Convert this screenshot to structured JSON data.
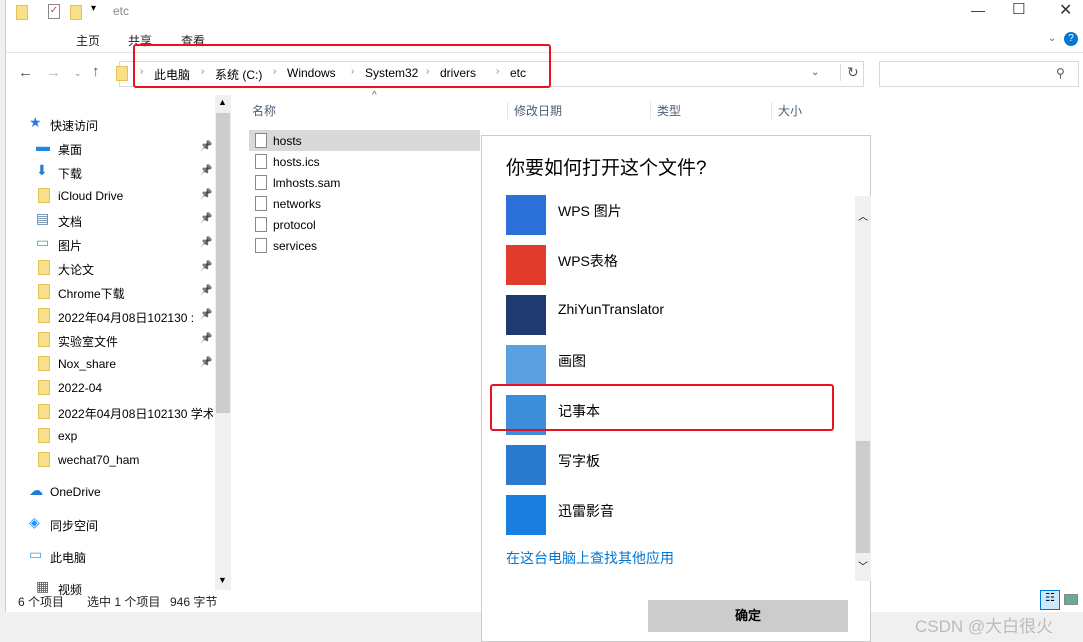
{
  "window": {
    "title": "etc",
    "tabs": [
      "主页",
      "共享",
      "查看"
    ]
  },
  "address": {
    "crumbs": [
      "此电脑",
      "系统 (C:)",
      "Windows",
      "System32",
      "drivers",
      "etc"
    ]
  },
  "sidebar": {
    "items": [
      {
        "label": "快速访问",
        "icon": "star-icon",
        "pinned": false,
        "indent": 0
      },
      {
        "label": "桌面",
        "icon": "desktop-icon",
        "pinned": true,
        "indent": 1
      },
      {
        "label": "下载",
        "icon": "download-icon",
        "pinned": true,
        "indent": 1
      },
      {
        "label": "iCloud Drive",
        "icon": "folder-icon",
        "pinned": true,
        "indent": 1
      },
      {
        "label": "文档",
        "icon": "document-icon",
        "pinned": true,
        "indent": 1
      },
      {
        "label": "图片",
        "icon": "picture-icon",
        "pinned": true,
        "indent": 1
      },
      {
        "label": "大论文",
        "icon": "folder-icon",
        "pinned": true,
        "indent": 1
      },
      {
        "label": "Chrome下载",
        "icon": "folder-icon",
        "pinned": true,
        "indent": 1
      },
      {
        "label": "2022年04月08日102130 :",
        "icon": "folder-icon",
        "pinned": true,
        "indent": 1
      },
      {
        "label": "实验室文件",
        "icon": "folder-icon",
        "pinned": true,
        "indent": 1
      },
      {
        "label": "Nox_share",
        "icon": "folder-icon",
        "pinned": true,
        "indent": 1
      },
      {
        "label": "2022-04",
        "icon": "folder-icon",
        "pinned": false,
        "indent": 1
      },
      {
        "label": "2022年04月08日102130 学术",
        "icon": "folder-icon",
        "pinned": false,
        "indent": 1
      },
      {
        "label": "exp",
        "icon": "folder-icon",
        "pinned": false,
        "indent": 1
      },
      {
        "label": "wechat70_ham",
        "icon": "folder-icon",
        "pinned": false,
        "indent": 1
      },
      {
        "label": "OneDrive",
        "icon": "cloud-icon",
        "pinned": false,
        "indent": 0
      },
      {
        "label": "同步空间",
        "icon": "sync-icon",
        "pinned": false,
        "indent": 0
      },
      {
        "label": "此电脑",
        "icon": "computer-icon",
        "pinned": false,
        "indent": 0
      },
      {
        "label": "视频",
        "icon": "video-icon",
        "pinned": false,
        "indent": 1
      }
    ]
  },
  "columns": [
    "名称",
    "修改日期",
    "类型",
    "大小"
  ],
  "files": [
    {
      "name": "hosts",
      "selected": true
    },
    {
      "name": "hosts.ics"
    },
    {
      "name": "lmhosts.sam"
    },
    {
      "name": "networks"
    },
    {
      "name": "protocol"
    },
    {
      "name": "services"
    }
  ],
  "status": {
    "count": "6 个项目",
    "selected": "选中 1 个项目",
    "size": "946 字节"
  },
  "dialog": {
    "title": "你要如何打开这个文件?",
    "apps": [
      {
        "name": "WPS 图片",
        "color": "#2b6fd8"
      },
      {
        "name": "WPS表格",
        "color": "#e03b2b"
      },
      {
        "name": "ZhiYunTranslator",
        "color": "#1e3a6e"
      },
      {
        "name": "画图",
        "color": "#5aa0e0"
      },
      {
        "name": "记事本",
        "color": "#3d8ed8",
        "highlighted": true
      },
      {
        "name": "写字板",
        "color": "#2a7bd0"
      },
      {
        "name": "迅雷影音",
        "color": "#1a7de0"
      }
    ],
    "link": "在这台电脑上查找其他应用",
    "ok": "确定"
  },
  "watermark": "CSDN @大白很火",
  "colors": {
    "accent": "#0078d7",
    "highlight": "#e81123"
  }
}
